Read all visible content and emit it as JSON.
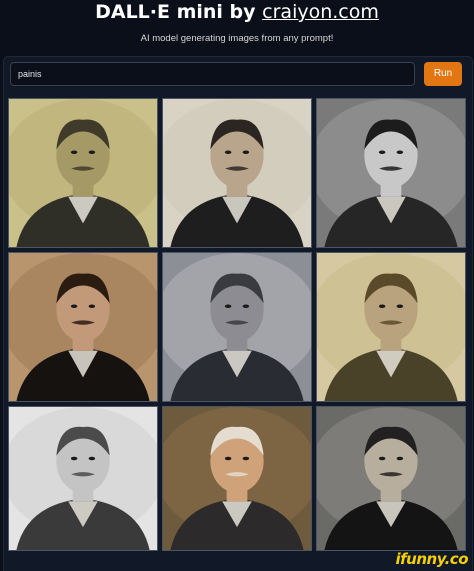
{
  "header": {
    "title_prefix": "DALL·E mini by",
    "title_link": "craiyon.com",
    "subtitle": "AI model generating images from any prompt!"
  },
  "prompt": {
    "value": "painis",
    "run_label": "Run"
  },
  "results": [
    {
      "background": "#c9c08a",
      "tone": "#b9ad72",
      "face": "#a59a66",
      "hair": "#3f3a2a",
      "coat": "#2f2f28"
    },
    {
      "background": "#d8d3c4",
      "tone": "#cfc9b8",
      "face": "#b9a58c",
      "hair": "#2b2622",
      "coat": "#1f1e1e"
    },
    {
      "background": "#7a7a7a",
      "tone": "#9a9a9a",
      "face": "#c8c8c8",
      "hair": "#1c1c1c",
      "coat": "#262626"
    },
    {
      "background": "#b8956c",
      "tone": "#9c7a57",
      "face": "#c29a7a",
      "hair": "#2b1c12",
      "coat": "#161210"
    },
    {
      "background": "#8c8f96",
      "tone": "#b4b6bb",
      "face": "#8c8c92",
      "hair": "#3a3b40",
      "coat": "#2a2c33"
    },
    {
      "background": "#d6c9a2",
      "tone": "#c9b987",
      "face": "#b9a27e",
      "hair": "#5a4a2a",
      "coat": "#4a4228"
    },
    {
      "background": "#e4e4e4",
      "tone": "#d0d0d0",
      "face": "#c4c4c4",
      "hair": "#4b4b4b",
      "coat": "#3a3a3a"
    },
    {
      "background": "#6e5a3c",
      "tone": "#8a7048",
      "face": "#d0a27a",
      "hair": "#e3dccf",
      "coat": "#2c2a2a"
    },
    {
      "background": "#6a6a66",
      "tone": "#8c8a86",
      "face": "#b8ae9e",
      "hair": "#222020",
      "coat": "#141414"
    }
  ],
  "watermark": "ifunny.co"
}
